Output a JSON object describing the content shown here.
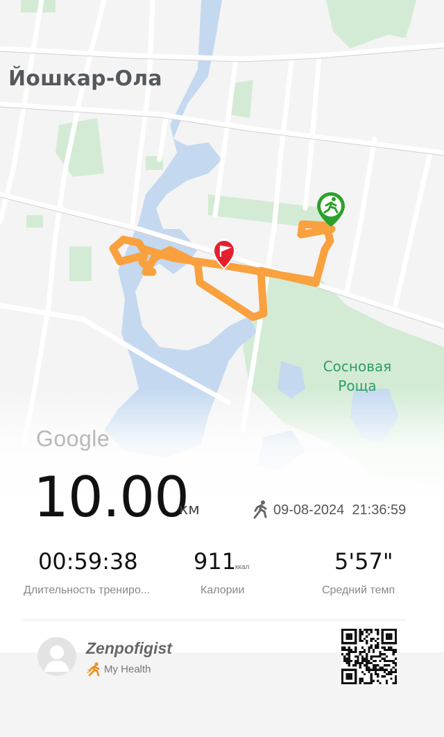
{
  "map": {
    "city_label": "Йошкар-Ола",
    "park_label_line1": "Сосновая",
    "park_label_line2": "Роща",
    "attribution": "Google",
    "colors": {
      "route": "#f9a13e",
      "start_pin": "#2aa12a",
      "finish_pin": "#e4202f",
      "water": "#c4d9f0",
      "park": "#d3ebd5"
    }
  },
  "workout": {
    "distance": "10.00",
    "distance_unit": "км",
    "activity_icon": "running-icon",
    "date": "09-08-2024",
    "time": "21:36:59"
  },
  "stats": {
    "duration": {
      "value": "00:59:38",
      "label": "Длительность трениро..."
    },
    "calories": {
      "value": "911",
      "unit": "ккал",
      "label": "Калории"
    },
    "pace": {
      "value": "5'57\"",
      "label": "Средний темп"
    }
  },
  "user": {
    "name": "Zenpofigist",
    "app_name": "My Health",
    "avatar_icon": "avatar-placeholder-icon",
    "qr_icon": "qr-code-icon"
  }
}
